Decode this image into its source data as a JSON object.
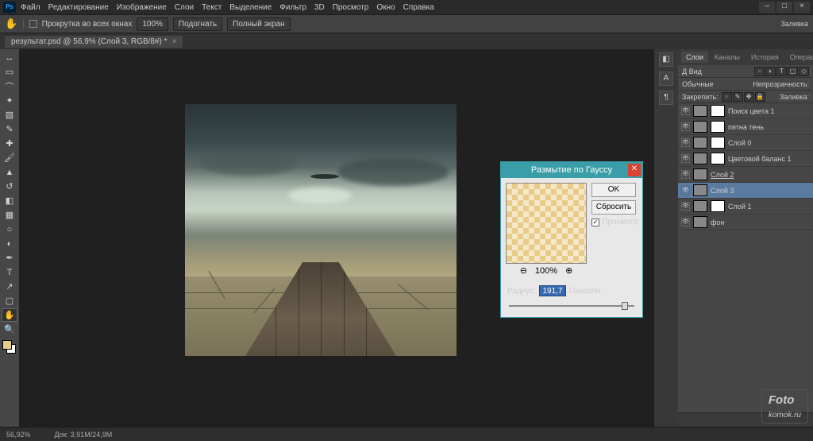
{
  "menu": {
    "items": [
      "Файл",
      "Редактирование",
      "Изображение",
      "Слои",
      "Текст",
      "Выделение",
      "Фильтр",
      "3D",
      "Просмотр",
      "Окно",
      "Справка"
    ]
  },
  "options": {
    "scroll_all": "Прокрутка во всех окнах",
    "zoom": "100%",
    "fit": "Подогнать",
    "fullscreen": "Полный экран",
    "fill": "Заливка"
  },
  "tab": {
    "title": "результат.psd @ 56,9% (Слой 3, RGB/8#) *"
  },
  "panel": {
    "tabs": [
      "Слои",
      "Каналы",
      "История",
      "Операции"
    ],
    "kind_label": "Д Вид",
    "blend": "Обычные",
    "opacity_label": "Непрозрачность:",
    "lock_label": "Закрепить:",
    "fill_label": "Заливка:"
  },
  "layers": [
    {
      "name": "Поиск цвета 1",
      "mask": true
    },
    {
      "name": "пятна тень",
      "mask": true
    },
    {
      "name": "Слой 0",
      "mask": true
    },
    {
      "name": "Цветовой баланс 1",
      "mask": true
    },
    {
      "name": "Слой 2",
      "mask": false,
      "u": true
    },
    {
      "name": "Слой 3",
      "mask": false,
      "sel": true
    },
    {
      "name": "Слой 1",
      "mask": true
    },
    {
      "name": "фон",
      "mask": false
    }
  ],
  "dialog": {
    "title": "Размытие по Гауссу",
    "ok": "OK",
    "reset": "Сбросить",
    "preview": "Просмотр",
    "zoom": "100%",
    "radius_label": "Радиус:",
    "radius_value": "191,7",
    "units": "Пиксели"
  },
  "status": {
    "zoom": "56,92%",
    "doc": "Док: 3,91M/24,9M"
  },
  "watermark": {
    "a": "Foto",
    "b": "komok.ru"
  }
}
